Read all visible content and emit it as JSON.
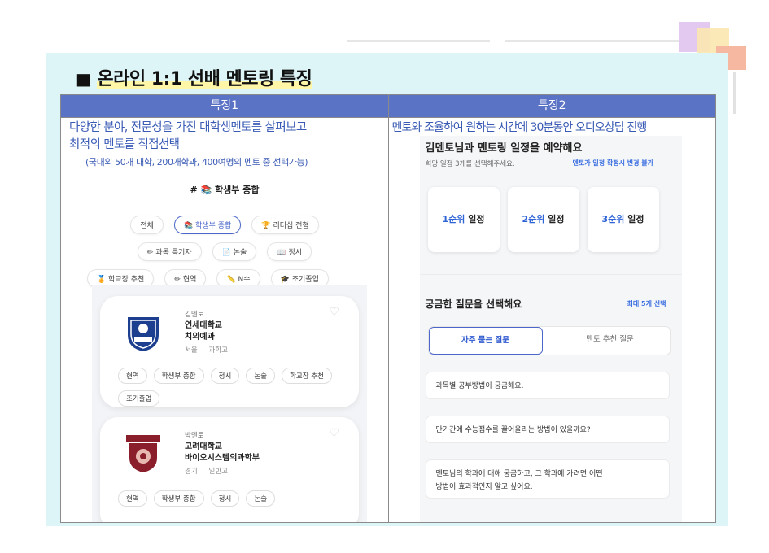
{
  "headline": {
    "mark": "■",
    "text": "온라인 1:1 선배 멘토링 특징"
  },
  "col1": {
    "header": "특징1",
    "desc_line1": "다양한 분야, 전문성을 가진 대학생멘토를 살펴보고",
    "desc_line2": "최적의 멘토를 직접선택",
    "desc_small": "(국내외 50개 대학, 200개학과, 400여명의 멘토 중 선택가능)",
    "hashtag_title": "# 📚 학생부 종합",
    "chip_rows": [
      [
        "전체",
        "📚 학생부 종합",
        "🏆 리더십 전형"
      ],
      [
        "✏ 과목 특기자",
        "📄 논술",
        "📖 정시"
      ],
      [
        "🏅 학교장 추천",
        "✏ 현역",
        "📏 N수",
        "🎓 조기졸업"
      ]
    ],
    "mentors": [
      {
        "name": "김멘토",
        "university": "연세대학교",
        "department": "치의예과",
        "location": "서울 ｜ 과학고",
        "logo_text": "YONSEI",
        "tags": [
          "현역",
          "학생부 종합",
          "정시",
          "논술",
          "학교장 추천",
          "조기졸업"
        ]
      },
      {
        "name": "박멘토",
        "university": "고려대학교",
        "department": "바이오시스템의과학부",
        "location": "경기 ｜ 일반고",
        "logo_text": "KOREA",
        "tags": [
          "현역",
          "학생부 종합",
          "정시",
          "논술"
        ]
      }
    ]
  },
  "col2": {
    "header": "특징2",
    "desc": "멘토와 조율하여 원하는 시간에 30분동안 오디오상담 진행",
    "title": "김멘토님과 멘토링 일정을 예약해요",
    "subtitle": "희망 일정 3개를 선택해주세요.",
    "warning": "멘토가 일정 확정시 변경 불가",
    "ranks": [
      {
        "strong": "1순위",
        "rest": " 일정"
      },
      {
        "strong": "2순위",
        "rest": " 일정"
      },
      {
        "strong": "3순위",
        "rest": " 일정"
      }
    ],
    "question_title": "궁금한 질문을 선택해요",
    "question_max": "최대 5개 선택",
    "tab_faq": "자주 묻는 질문",
    "tab_mentor": "멘토 추천 질문",
    "questions": [
      "과목별 공부방법이 궁금해요.",
      "단기간에 수능점수를 끌어올리는 방법이 있을까요?",
      "멘토님의 학과에 대해 궁금하고, 그 학과에 가려면 어떤",
      "방법이 효과적인지 알고 싶어요."
    ]
  },
  "colors": {
    "header_bg": "#5b73c5",
    "desc_text": "#3a5bb5",
    "slide_bg": "#ddf5f6",
    "accent_blue": "#2f64d6"
  }
}
